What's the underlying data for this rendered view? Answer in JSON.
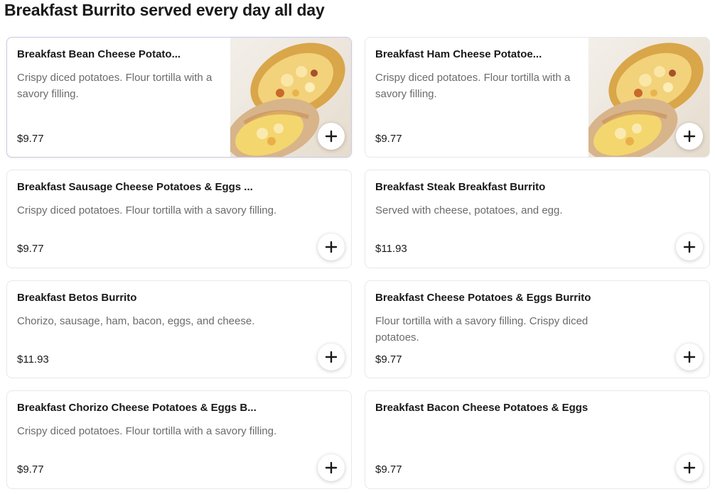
{
  "section": {
    "title": "Breakfast Burrito served every day all day"
  },
  "items": [
    {
      "name": "Breakfast Bean Cheese Potato...",
      "description": "Crispy diced potatoes. Flour tortilla with a savory filling.",
      "price": "$9.77",
      "image": "burrito-photo"
    },
    {
      "name": "Breakfast Ham Cheese Potatoe...",
      "description": "Crispy diced potatoes. Flour tortilla with a savory filling.",
      "price": "$9.77",
      "image": "burrito-photo"
    },
    {
      "name": "Breakfast Sausage Cheese Potatoes & Eggs ...",
      "description": "Crispy diced potatoes. Flour tortilla with a savory filling.",
      "price": "$9.77"
    },
    {
      "name": "Breakfast Steak Breakfast Burrito",
      "description": "Served with cheese, potatoes, and egg.",
      "price": "$11.93"
    },
    {
      "name": "Breakfast Betos Burrito",
      "description": "Chorizo, sausage, ham, bacon, eggs, and cheese.",
      "price": "$11.93"
    },
    {
      "name": "Breakfast Cheese Potatoes & Eggs Burrito",
      "description": "Flour tortilla with a savory filling. Crispy diced potatoes.",
      "price": "$9.77"
    },
    {
      "name": "Breakfast Chorizo Cheese Potatoes & Eggs B...",
      "description": "Crispy diced potatoes. Flour tortilla with a savory filling.",
      "price": "$9.77"
    },
    {
      "name": "Breakfast Bacon Cheese Potatoes & Eggs",
      "description": "",
      "price": "$9.77"
    }
  ],
  "icons": {
    "add": "plus-icon"
  }
}
